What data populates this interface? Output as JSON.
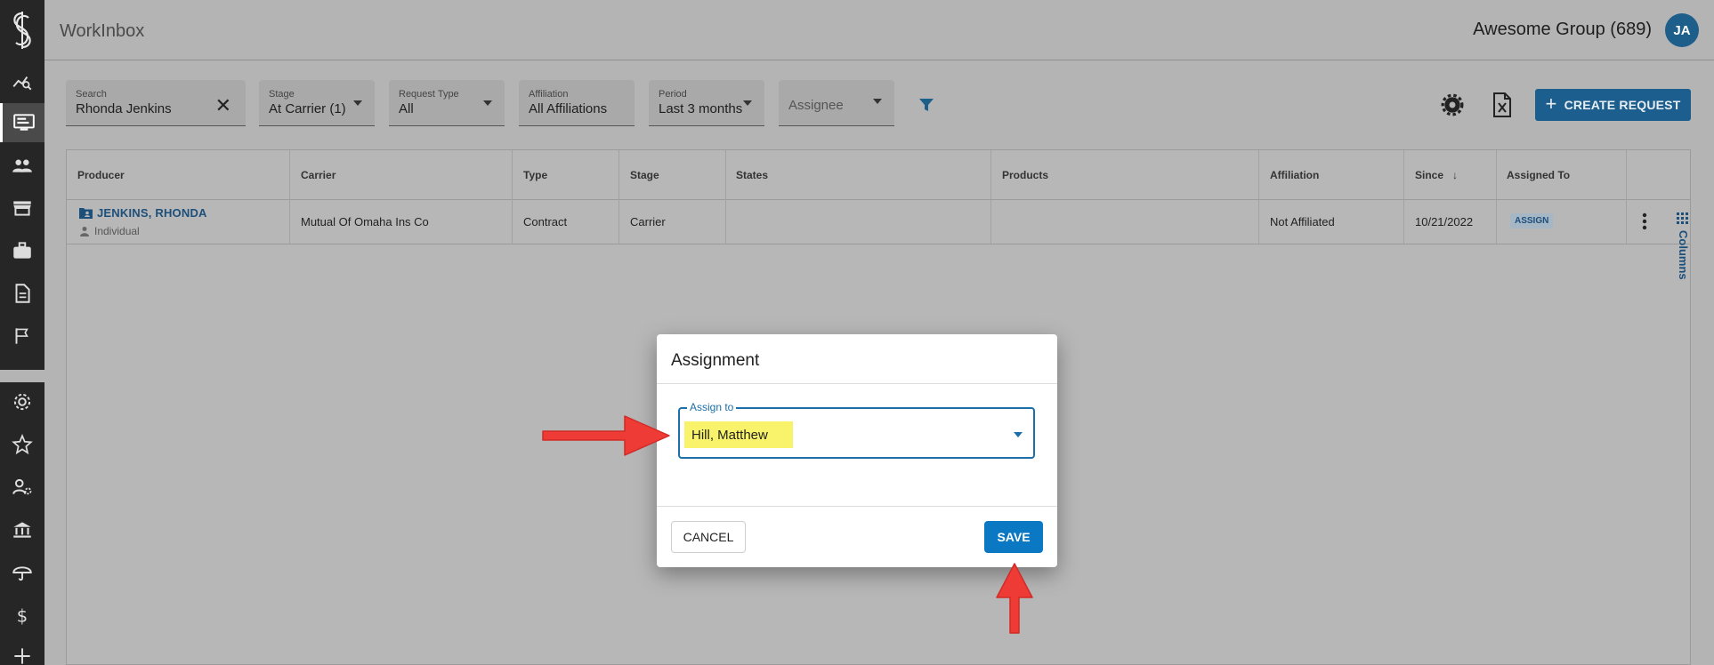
{
  "app": {
    "title": "WorkInbox",
    "group": "Awesome Group (689)",
    "avatar_initials": "JA"
  },
  "nav": {
    "items": [
      "dashboard-icon",
      "work-inbox-icon",
      "people-icon",
      "store-icon",
      "briefcase-icon",
      "document-icon",
      "flag-icon",
      "gear-icon",
      "badge-icon",
      "user-settings-icon",
      "bank-icon",
      "umbrella-icon",
      "dollar-icon",
      "flow-icon"
    ],
    "active": "work-inbox-icon"
  },
  "filters": {
    "search": {
      "label": "Search",
      "value": "Rhonda Jenkins"
    },
    "stage": {
      "label": "Stage",
      "value": "At Carrier (1)"
    },
    "request_type": {
      "label": "Request Type",
      "value": "All"
    },
    "affiliation": {
      "label": "Affiliation",
      "value": "All Affiliations"
    },
    "period": {
      "label": "Period",
      "value": "Last 3 months"
    },
    "assignee": {
      "placeholder": "Assignee"
    }
  },
  "toolbar": {
    "create_label": "CREATE REQUEST"
  },
  "table": {
    "columns": [
      "Producer",
      "Carrier",
      "Type",
      "Stage",
      "States",
      "Products",
      "Affiliation",
      "Since",
      "Assigned To"
    ],
    "sort_indicator": "↓",
    "rows": [
      {
        "producer": "JENKINS, RHONDA",
        "producer_type": "Individual",
        "carrier": "Mutual Of Omaha Ins Co",
        "type": "Contract",
        "stage": "Carrier",
        "states": "",
        "products": "",
        "affiliation": "Not Affiliated",
        "since": "10/21/2022",
        "assigned_to": "ASSIGN"
      }
    ],
    "columns_tab": "Columns"
  },
  "dialog": {
    "title": "Assignment",
    "assign_label": "Assign to",
    "assign_value": "Hill, Matthew",
    "cancel_label": "CANCEL",
    "save_label": "SAVE"
  },
  "colors": {
    "accent": "#0a78c2",
    "highlight": "#f8f36a",
    "annotation_arrow": "#ef3b36"
  }
}
